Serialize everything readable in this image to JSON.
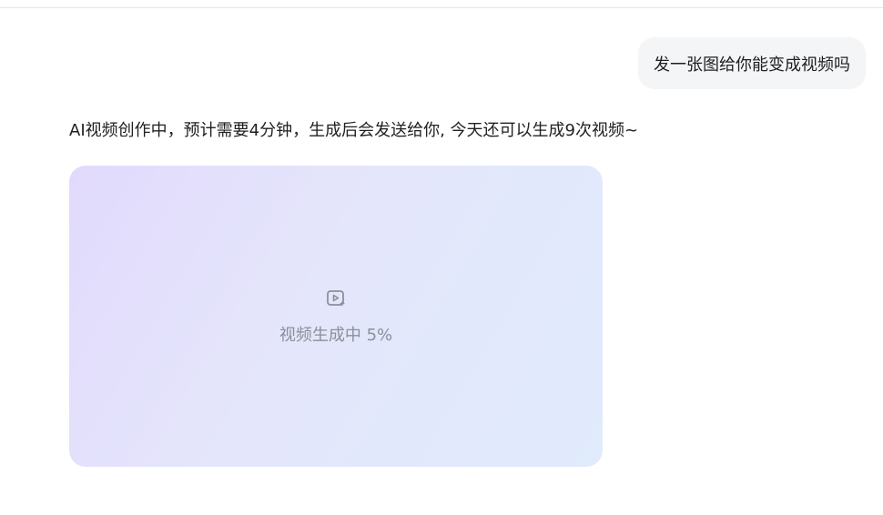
{
  "conversation": {
    "user_message": "发一张图给你能变成视频吗",
    "assistant_message": "AI视频创作中，预计需要4分钟，生成后会发送给你, 今天还可以生成9次视频~"
  },
  "video_card": {
    "status_text": "视频生成中 5%",
    "progress_percent": 5,
    "icon": "video-sparkle-icon",
    "gradient_colors": [
      "#e2dafc",
      "#e4e6fb",
      "#e0ebfc"
    ]
  }
}
